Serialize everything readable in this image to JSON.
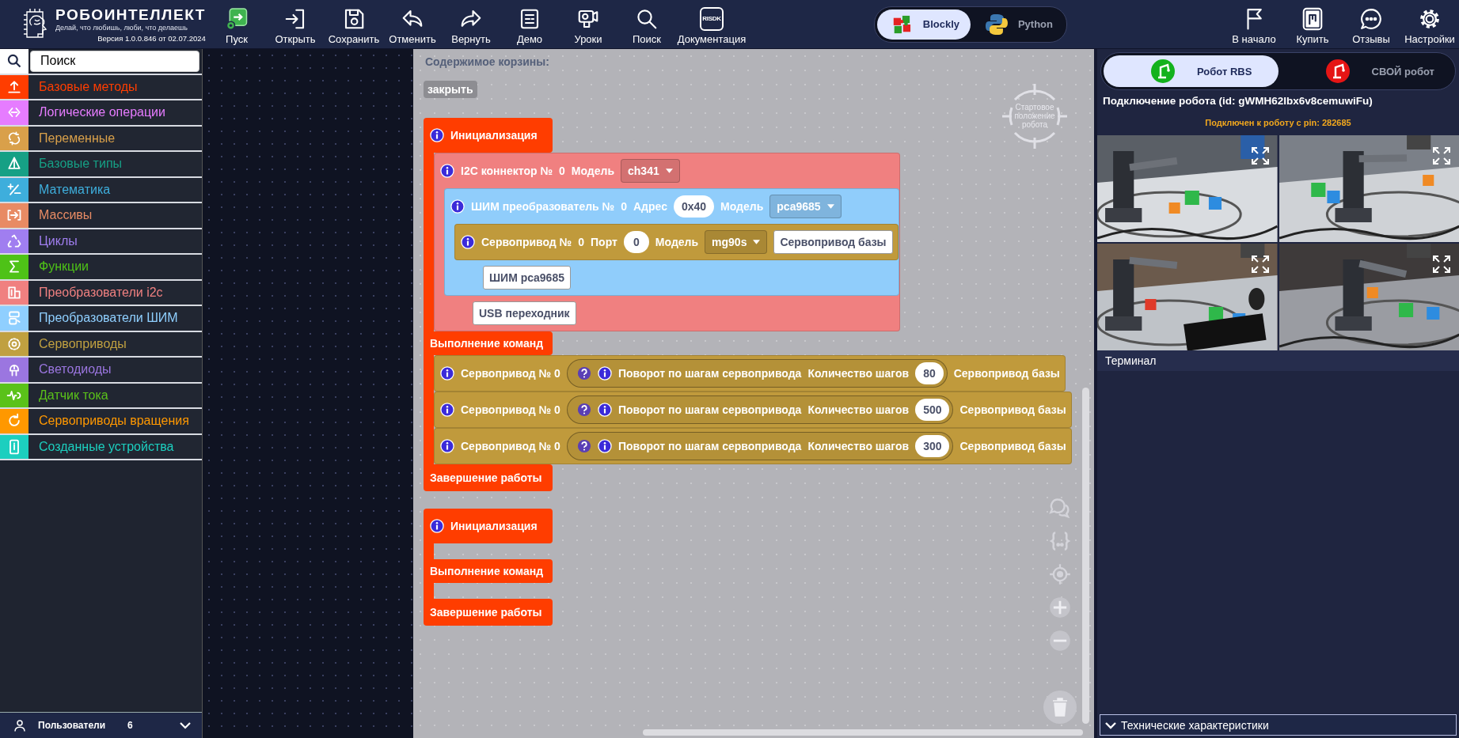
{
  "header": {
    "logo": {
      "title": "РОБОИНТЕЛЛЕКТ",
      "tagline": "Делай, что любишь, люби, что делаешь",
      "version": "Версия 1.0.0.846 от 02.07.2024"
    },
    "tools": [
      {
        "kind": "run",
        "label": "Пуск"
      },
      {
        "kind": "open",
        "label": "Открыть"
      },
      {
        "kind": "save",
        "label": "Сохранить"
      },
      {
        "kind": "undo",
        "label": "Отменить"
      },
      {
        "kind": "redo",
        "label": "Вернуть"
      },
      {
        "kind": "demo",
        "label": "Демо"
      },
      {
        "kind": "lessons",
        "label": "Уроки"
      },
      {
        "kind": "search",
        "label": "Поиск"
      },
      {
        "kind": "docs",
        "label": "Документация",
        "icon_text": "RISDK"
      }
    ],
    "mode_switch": [
      {
        "kind": "blockly",
        "label": "Blockly",
        "selected": true
      },
      {
        "kind": "python",
        "label": "Python",
        "selected": false
      }
    ],
    "right_tools": [
      {
        "kind": "flag",
        "label": "В начало"
      },
      {
        "kind": "buy",
        "label": "Купить"
      },
      {
        "kind": "reviews",
        "label": "Отзывы"
      },
      {
        "kind": "settings",
        "label": "Настройки"
      }
    ]
  },
  "sidebar": {
    "search": {
      "placeholder": "Поиск"
    },
    "categories": [
      {
        "kind": "methods",
        "label": "Базовые методы",
        "color": "#ff3d00"
      },
      {
        "kind": "logic",
        "label": "Логические операции",
        "color": "#e67cff"
      },
      {
        "kind": "variables",
        "label": "Переменные",
        "color": "#d9a04a"
      },
      {
        "kind": "types",
        "label": "Базовые типы",
        "color": "#16a085"
      },
      {
        "kind": "math",
        "label": "Математика",
        "color": "#3eaedc"
      },
      {
        "kind": "arrays",
        "label": "Массивы",
        "color": "#e88b64"
      },
      {
        "kind": "loops",
        "label": "Циклы",
        "color": "#a07ef0"
      },
      {
        "kind": "functions",
        "label": "Функции",
        "color": "#4ec217"
      },
      {
        "kind": "i2c",
        "label": "Преобразователи i2c",
        "color": "#f08080"
      },
      {
        "kind": "pwm",
        "label": "Преобразователи ШИМ",
        "color": "#8fcfff"
      },
      {
        "kind": "servo",
        "label": "Сервоприводы",
        "color": "#c0a040"
      },
      {
        "kind": "led",
        "label": "Светодиоды",
        "color": "#9b76e0"
      },
      {
        "kind": "current",
        "label": "Датчик тока",
        "color": "#5ac21a"
      },
      {
        "kind": "rotation",
        "label": "Сервоприводы вращения",
        "color": "#ff9800"
      },
      {
        "kind": "devices",
        "label": "Созданные устройства",
        "color": "#1ccfbf"
      }
    ],
    "footer": {
      "label": "Пользователи",
      "count": "6"
    }
  },
  "trash": {
    "title": "Содержимое корзины:",
    "close": "закрыть",
    "start_position": "Стартовое положение робота",
    "programs": [
      {
        "color": "#ff3d00",
        "sections": [
          {
            "label": "Инициализация",
            "children": [
              {
                "color": "#f08080",
                "fields": [
                  {
                    "kind": "info"
                  },
                  {
                    "kind": "label",
                    "text": "I2C коннектор №"
                  },
                  {
                    "kind": "label",
                    "text": "0"
                  },
                  {
                    "kind": "label",
                    "text": "Модель"
                  },
                  {
                    "kind": "dropdown",
                    "text": "ch341"
                  }
                ],
                "children": [
                  {
                    "color": "#90cdfb",
                    "fields": [
                      {
                        "kind": "info"
                      },
                      {
                        "kind": "label",
                        "text": "ШИМ преобразователь №"
                      },
                      {
                        "kind": "label",
                        "text": "0"
                      },
                      {
                        "kind": "label",
                        "text": "Адрес"
                      },
                      {
                        "kind": "number",
                        "text": "0x40"
                      },
                      {
                        "kind": "label",
                        "text": "Модель"
                      },
                      {
                        "kind": "dropdown",
                        "text": "pca9685"
                      }
                    ],
                    "children": [
                      {
                        "color": "#c09a3c",
                        "fields": [
                          {
                            "kind": "info"
                          },
                          {
                            "kind": "label",
                            "text": "Сервопривод №"
                          },
                          {
                            "kind": "label",
                            "text": "0"
                          },
                          {
                            "kind": "label",
                            "text": "Порт"
                          },
                          {
                            "kind": "number",
                            "text": "0"
                          },
                          {
                            "kind": "label",
                            "text": "Модель"
                          },
                          {
                            "kind": "dropdown",
                            "text": "mg90s"
                          },
                          {
                            "kind": "text",
                            "text": "Сервопривод базы"
                          }
                        ]
                      }
                    ],
                    "footer": [
                      {
                        "kind": "text",
                        "text": "ШИМ pca9685"
                      }
                    ]
                  }
                ],
                "footer": [
                  {
                    "kind": "text",
                    "text": "USB переходник"
                  }
                ]
              }
            ]
          },
          {
            "label": "Выполнение команд",
            "children": [
              {
                "color": "#c09a3c",
                "fields": [
                  {
                    "kind": "info"
                  },
                  {
                    "kind": "label",
                    "text": "Сервопривод № 0"
                  },
                  {
                    "kind": "reporter",
                    "fields": [
                      {
                        "kind": "help"
                      },
                      {
                        "kind": "info"
                      },
                      {
                        "kind": "label",
                        "text": "Поворот по шагам сервопривода"
                      },
                      {
                        "kind": "label",
                        "text": "Количество шагов"
                      },
                      {
                        "kind": "number",
                        "text": "80"
                      }
                    ]
                  },
                  {
                    "kind": "label",
                    "text": "Сервопривод базы"
                  }
                ]
              },
              {
                "color": "#c09a3c",
                "fields": [
                  {
                    "kind": "info"
                  },
                  {
                    "kind": "label",
                    "text": "Сервопривод № 0"
                  },
                  {
                    "kind": "reporter",
                    "fields": [
                      {
                        "kind": "help"
                      },
                      {
                        "kind": "info"
                      },
                      {
                        "kind": "label",
                        "text": "Поворот по шагам сервопривода"
                      },
                      {
                        "kind": "label",
                        "text": "Количество шагов"
                      },
                      {
                        "kind": "number",
                        "text": "500"
                      }
                    ]
                  },
                  {
                    "kind": "label",
                    "text": "Сервопривод базы"
                  }
                ]
              },
              {
                "color": "#c09a3c",
                "fields": [
                  {
                    "kind": "info"
                  },
                  {
                    "kind": "label",
                    "text": "Сервопривод № 0"
                  },
                  {
                    "kind": "reporter",
                    "fields": [
                      {
                        "kind": "help"
                      },
                      {
                        "kind": "info"
                      },
                      {
                        "kind": "label",
                        "text": "Поворот по шагам сервопривода"
                      },
                      {
                        "kind": "label",
                        "text": "Количество шагов"
                      },
                      {
                        "kind": "number",
                        "text": "300"
                      }
                    ]
                  },
                  {
                    "kind": "label",
                    "text": "Сервопривод базы"
                  }
                ]
              }
            ]
          },
          {
            "label": "Завершение работы"
          }
        ]
      },
      {
        "color": "#ff3d00",
        "sections": [
          {
            "label": "Инициализация"
          },
          {
            "label": "Выполнение команд"
          },
          {
            "label": "Завершение работы"
          }
        ]
      }
    ]
  },
  "robot_panel": {
    "tabs": [
      {
        "kind": "rbs",
        "label": "Робот RBS",
        "selected": true
      },
      {
        "kind": "own",
        "label": "СВОЙ робот",
        "selected": false
      }
    ],
    "connection": "Подключение робота (id: gWMH62Ibx6v8cemuwiFu)",
    "pin_status": "Подключен к роботу с pin: 282685",
    "terminal": "Терминал",
    "specs": "Технические характеристики"
  }
}
